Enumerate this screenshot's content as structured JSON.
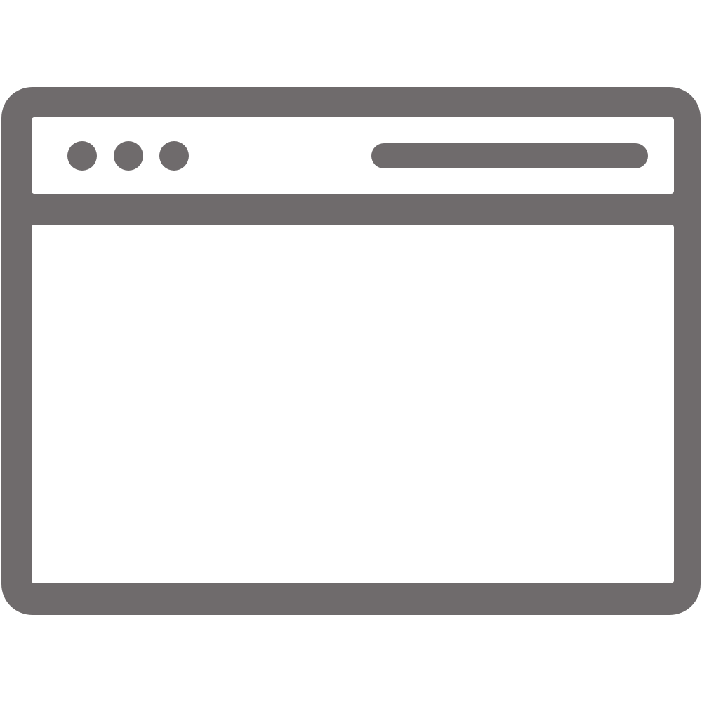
{
  "icon": {
    "name": "browser-window-icon",
    "frame_color": "#6f6b6c",
    "background_color": "#ffffff",
    "window_controls": [
      "dot-icon",
      "dot-icon",
      "dot-icon"
    ],
    "address_bar_icon": "address-bar-line-icon"
  }
}
